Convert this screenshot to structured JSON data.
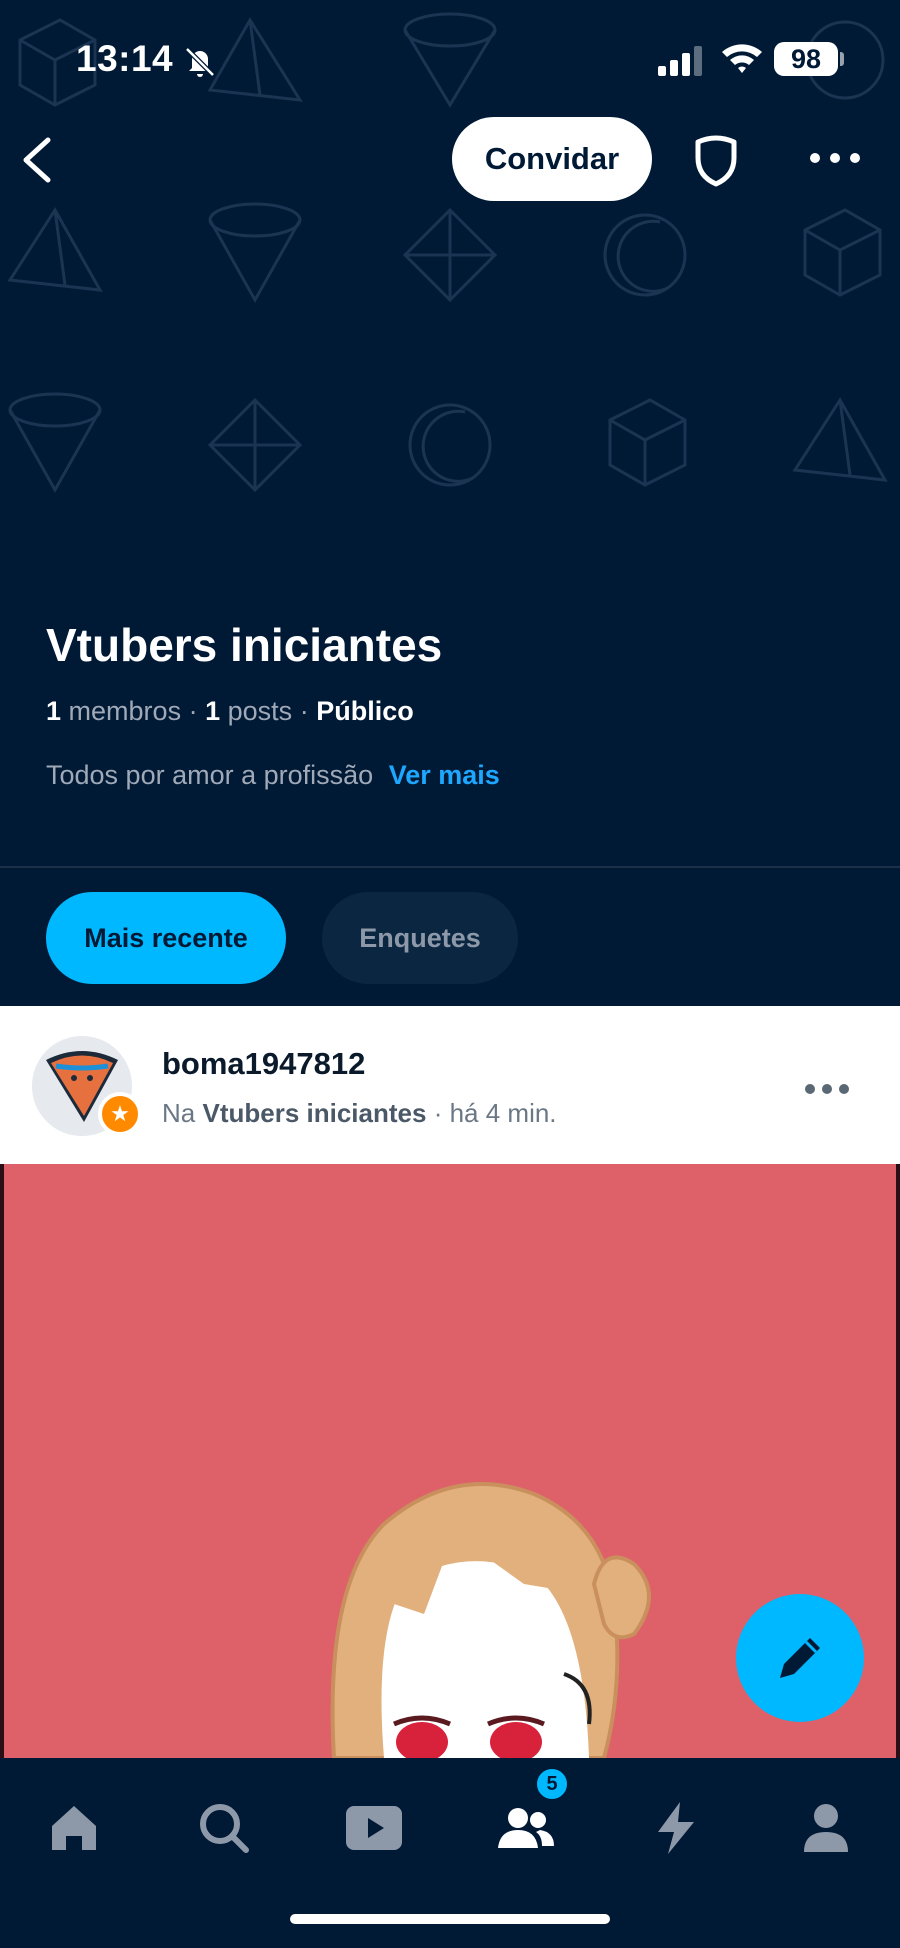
{
  "status_bar": {
    "time": "13:14",
    "battery": "98"
  },
  "header": {
    "invite_label": "Convidar"
  },
  "group": {
    "title": "Vtubers iniciantes",
    "members_count": "1",
    "members_label": "membros",
    "posts_count": "1",
    "posts_label": "posts",
    "visibility": "Público",
    "description": "Todos por amor a profissão",
    "see_more": "Ver mais"
  },
  "filters": [
    {
      "label": "Mais recente",
      "active": true
    },
    {
      "label": "Enquetes",
      "active": false
    }
  ],
  "post": {
    "username": "boma1947812",
    "prefix": "Na",
    "group_name": "Vtubers iniciantes",
    "time": "há 4 min."
  },
  "tabbar": {
    "items": [
      "home-icon",
      "search-icon",
      "video-icon",
      "community-icon",
      "activity-icon",
      "profile-icon"
    ],
    "community_badge": "5"
  },
  "colors": {
    "background": "#001935",
    "accent": "#00b8ff",
    "link": "#1ea7ff",
    "post_image": "#de6069"
  }
}
